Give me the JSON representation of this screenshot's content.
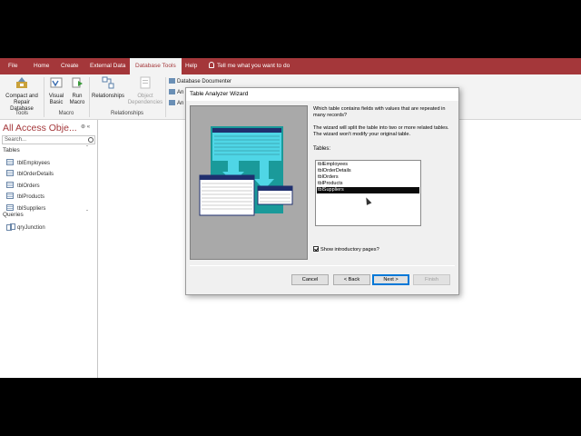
{
  "ribbon_tabs": [
    "File",
    "Home",
    "Create",
    "External Data",
    "Database Tools",
    "Help"
  ],
  "active_tab": "Database Tools",
  "tell_me": "Tell me what you want to do",
  "ribbon": {
    "compact_repair": "Compact and\nRepair Database",
    "visual_basic": "Visual\nBasic",
    "run_macro": "Run\nMacro",
    "relationships": "Relationships",
    "object_dependencies": "Object\nDependencies",
    "database_documenter": "Database Documenter",
    "analyze_1": "An",
    "analyze_2": "An",
    "group_tools": "Tools",
    "group_macro": "Macro",
    "group_relationships": "Relationships"
  },
  "nav": {
    "title": "All Access Obje...",
    "controls": "⊛ «",
    "search_placeholder": "Search...",
    "tables_header": "Tables",
    "tables": [
      "tblEmployees",
      "tblOrderDetails",
      "tblOrders",
      "tblProducts",
      "tblSuppliers"
    ],
    "queries_header": "Queries",
    "queries": [
      "qryJunction"
    ],
    "collapse_glyph": "ˆ"
  },
  "dialog": {
    "title": "Table Analyzer Wizard",
    "instruction_1": "Which table contains fields with values that are repeated in many records?",
    "instruction_2": "The wizard will split the table into two or more related tables. The wizard won't modify your original table.",
    "tables_label": "Tables:",
    "tables": [
      "tblEmployees",
      "tblOrderDetails",
      "tblOrders",
      "tblProducts",
      "tblSuppliers"
    ],
    "selected_table": "tblSuppliers",
    "show_intro_label": "Show introductory pages?",
    "show_intro_checked": true,
    "cancel": "Cancel",
    "back": "< Back",
    "next": "Next >",
    "finish": "Finish",
    "illustration_text": "XXXXXX XXXXXX XXX"
  },
  "colors": {
    "accent": "#a4373a",
    "illustration_teal": "#1a9a9a",
    "illustration_cyan": "#4fd6e6",
    "illustration_navy": "#1f2f6e"
  }
}
